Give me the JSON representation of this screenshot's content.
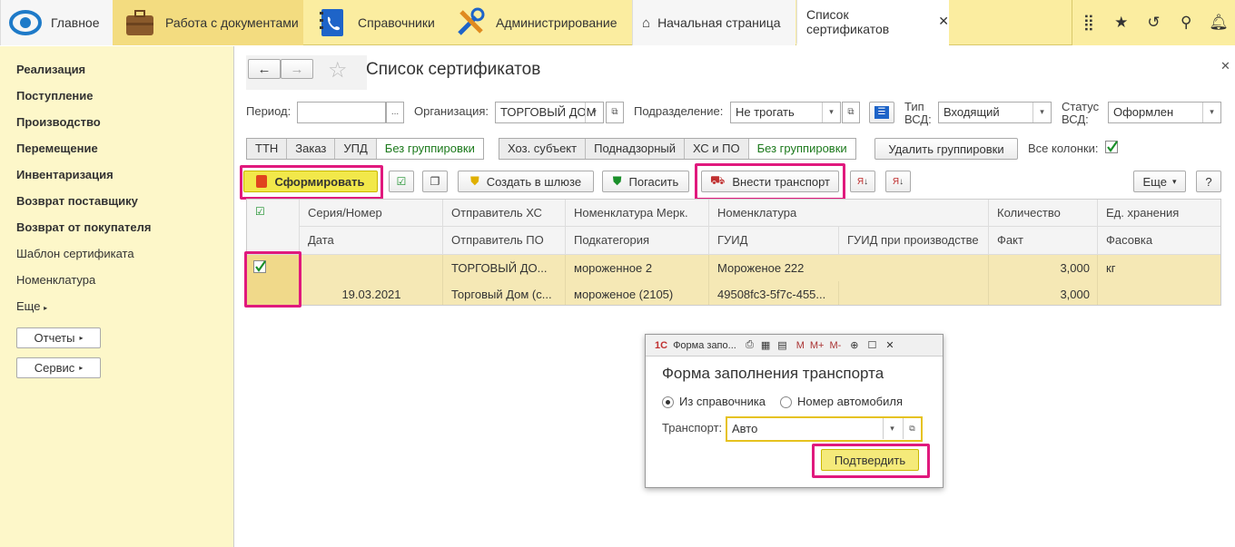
{
  "topbar": {
    "main": "Главное",
    "docs": "Работа с документами",
    "refs": "Справочники",
    "admin": "Администрирование",
    "tab_home": "Начальная страница",
    "tab_certs": "Список сертификатов"
  },
  "sidebar": {
    "items": [
      "Реализация",
      "Поступление",
      "Производство",
      "Перемещение",
      "Инвентаризация",
      "Возврат поставщику",
      "Возврат от покупателя",
      "Шаблон сертификата",
      "Номенклатура",
      "Еще"
    ],
    "reports": "Отчеты",
    "service": "Сервис"
  },
  "form": {
    "title": "Список сертификатов",
    "period_label": "Период:",
    "period_btn": "...",
    "org_label": "Организация:",
    "org_value": "ТОРГОВЫЙ ДОМ",
    "div_label": "Подразделение:",
    "div_value": "Не трогать",
    "type_label1": "Тип",
    "type_label2": "ВСД:",
    "type_value": "Входящий",
    "status_label1": "Статус",
    "status_label2": "ВСД:",
    "status_value": "Оформлен",
    "group1": [
      "ТТН",
      "Заказ",
      "УПД",
      "Без группировки"
    ],
    "group2": [
      "Хоз. субъект",
      "Поднадзорный",
      "ХС и ПО",
      "Без группировки"
    ],
    "delete_groups": "Удалить группировки",
    "all_columns": "Все колонки:",
    "btn_generate": "Сформировать",
    "btn_create_gw": "Создать в шлюзе",
    "btn_redeem": "Погасить",
    "btn_transport": "Внести транспорт",
    "btn_more": "Еще",
    "btn_help": "?"
  },
  "table": {
    "headers1": [
      "Серия/Номер",
      "Отправитель ХС",
      "Номенклатура Мерк.",
      "Номенклатура",
      "Количество",
      "Ед. хранения"
    ],
    "headers2": [
      "Дата",
      "Отправитель ПО",
      "Подкатегория",
      "ГУИД",
      "ГУИД при производстве",
      "Факт",
      "Фасовка"
    ],
    "row1": [
      "",
      "ТОРГОВЫЙ ДО...",
      "мороженное 2",
      "Мороженое 222",
      "3,000",
      "кг"
    ],
    "row2": [
      "19.03.2021",
      "Торговый Дом (с...",
      "мороженое (2105)",
      "49508fc3-5f7c-455...",
      "",
      "3,000",
      ""
    ]
  },
  "dialog": {
    "bar_title": "Форма запо...",
    "title": "Форма заполнения транспорта",
    "opt1": "Из справочника",
    "opt2": "Номер автомобиля",
    "transport_label": "Транспорт:",
    "transport_value": "Авто",
    "confirm": "Подтвердить"
  },
  "colors": {
    "highlight": "#e0197d",
    "accent_yellow": "#f5e8b5",
    "topbar": "#fbeda0"
  }
}
